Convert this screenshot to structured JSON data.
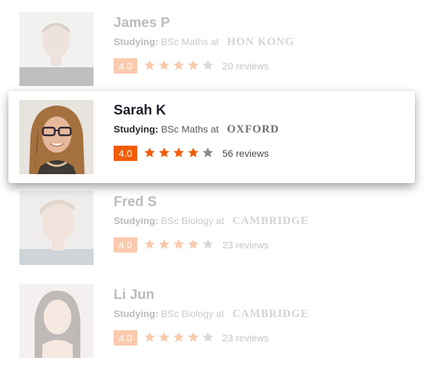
{
  "tutors": [
    {
      "name": "James P",
      "studying_label": "Studying:",
      "course": "BSc Maths at",
      "university": "HON KONG",
      "rating": "4.0",
      "reviews": "20 reviews",
      "stars_filled": 4,
      "state": "faded"
    },
    {
      "name": "Sarah K",
      "studying_label": "Studying:",
      "course": "BSc Maths at",
      "university": "OXFORD",
      "rating": "4.0",
      "reviews": "56 reviews",
      "stars_filled": 4,
      "state": "highlighted"
    },
    {
      "name": "Fred S",
      "studying_label": "Studying:",
      "course": "BSc Biology at",
      "university": "CAMBRIDGE",
      "rating": "4.0",
      "reviews": "23 reviews",
      "stars_filled": 4,
      "state": "faded"
    },
    {
      "name": "Li Jun",
      "studying_label": "Studying:",
      "course": "BSc Biology at",
      "university": "CAMBRIDGE",
      "rating": "4.0",
      "reviews": "23 reviews",
      "stars_filled": 4,
      "state": "faded"
    }
  ],
  "colors": {
    "accent": "#f25c05",
    "star_filled": "#f25c05",
    "star_empty": "#8a8a8a"
  },
  "icons": {
    "star": "star-icon",
    "avatar": "avatar-photo"
  }
}
